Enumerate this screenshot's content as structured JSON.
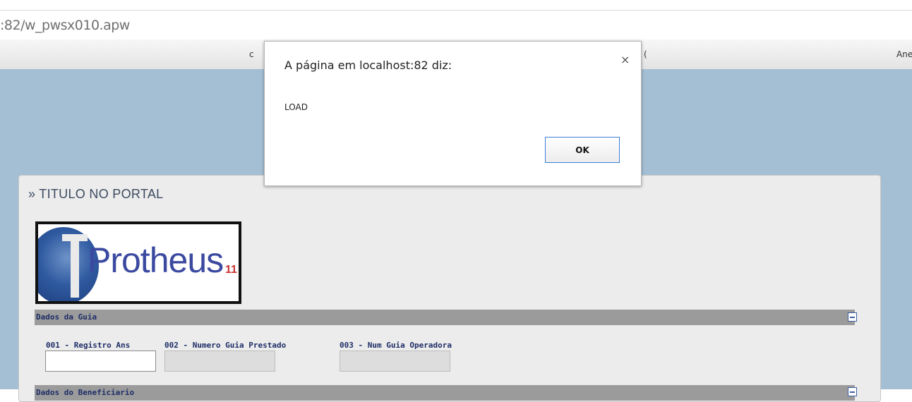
{
  "browser": {
    "url": ":82/w_pwsx010.apw"
  },
  "menu": {
    "frag_left": "c",
    "frag_mid": "(",
    "frag_right": "Ane"
  },
  "page": {
    "title": "» TITULO NO PORTAL"
  },
  "logo": {
    "text": "Protheus",
    "version": "11"
  },
  "sections": [
    {
      "label": "Dados da Guia"
    },
    {
      "label": "Dados do Beneficiario"
    }
  ],
  "fields": [
    {
      "label": "001 - Registro Ans",
      "value": ""
    },
    {
      "label": "002 - Numero Guia Prestado",
      "value": ""
    },
    {
      "label": "003 - Num Guia Operadora",
      "value": ""
    }
  ],
  "dialog": {
    "title": "A página em localhost:82 diz:",
    "message": "LOAD",
    "ok_label": "OK",
    "close_glyph": "×"
  }
}
